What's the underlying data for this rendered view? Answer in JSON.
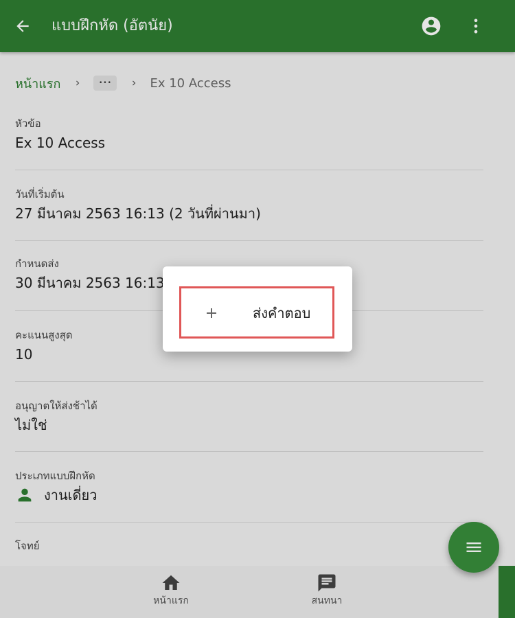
{
  "appbar": {
    "title": "แบบฝึกหัด (อัตนัย)",
    "icons": {
      "back": "arrow-back-icon",
      "account": "account-circle-icon",
      "more": "more-vert-icon"
    }
  },
  "breadcrumb": {
    "home": "หน้าแรก",
    "ellipsis": "•••",
    "current": "Ex 10 Access"
  },
  "fields": [
    {
      "label": "หัวข้อ",
      "value": "Ex 10 Access"
    },
    {
      "label": "วันที่เริ่มต้น",
      "value": "27 มีนาคม 2563 16:13  (2 วันที่ผ่านมา)"
    },
    {
      "label": "กำหนดส่ง",
      "value": "30 มีนาคม 2563 16:13"
    },
    {
      "label": "คะแนนสูงสุด",
      "value": "10"
    },
    {
      "label": "อนุญาตให้ส่งช้าได้",
      "value": "ไม่ใช่"
    },
    {
      "label": "ประเภทแบบฝึกหัด",
      "value": "งานเดี่ยว",
      "icon": "person-icon"
    },
    {
      "label": "โจทย์",
      "value": ""
    }
  ],
  "menu": {
    "item_label": "ส่งคำตอบ",
    "item_icon": "plus-icon"
  },
  "bottom_nav": [
    {
      "label": "หน้าแรก",
      "icon": "home-icon"
    },
    {
      "label": "สนทนา",
      "icon": "chat-icon"
    }
  ],
  "fab": {
    "icon": "menu-icon"
  },
  "colors": {
    "primary": "#2e7d32",
    "fab": "#388e3c",
    "highlight_border": "#e05757"
  }
}
